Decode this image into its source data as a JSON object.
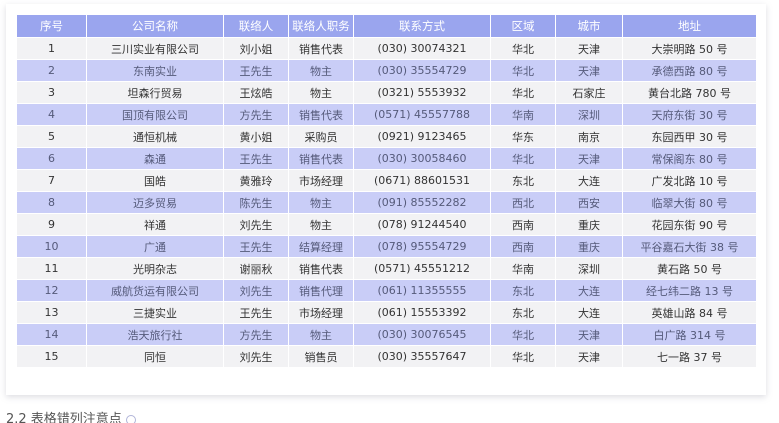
{
  "table": {
    "headers": [
      "序号",
      "公司名称",
      "联络人",
      "联络人职务",
      "联系方式",
      "区域",
      "城市",
      "地址"
    ],
    "rows": [
      [
        "1",
        "三川实业有限公司",
        "刘小姐",
        "销售代表",
        "(030) 30074321",
        "华北",
        "天津",
        "大崇明路 50 号"
      ],
      [
        "2",
        "东南实业",
        "王先生",
        "物主",
        "(030) 35554729",
        "华北",
        "天津",
        "承德西路 80 号"
      ],
      [
        "3",
        "坦森行贸易",
        "王炫皓",
        "物主",
        "(0321) 5553932",
        "华北",
        "石家庄",
        "黄台北路 780 号"
      ],
      [
        "4",
        "国顶有限公司",
        "方先生",
        "销售代表",
        "(0571) 45557788",
        "华南",
        "深圳",
        "天府东街 30 号"
      ],
      [
        "5",
        "通恒机械",
        "黄小姐",
        "采购员",
        "(0921) 9123465",
        "华东",
        "南京",
        "东园西甲 30 号"
      ],
      [
        "6",
        "森通",
        "王先生",
        "销售代表",
        "(030) 30058460",
        "华北",
        "天津",
        "常保阁东 80 号"
      ],
      [
        "7",
        "国皓",
        "黄雅玲",
        "市场经理",
        "(0671) 88601531",
        "东北",
        "大连",
        "广发北路 10 号"
      ],
      [
        "8",
        "迈多贸易",
        "陈先生",
        "物主",
        "(091) 85552282",
        "西北",
        "西安",
        "临翠大街 80 号"
      ],
      [
        "9",
        "祥通",
        "刘先生",
        "物主",
        "(078) 91244540",
        "西南",
        "重庆",
        "花园东街 90 号"
      ],
      [
        "10",
        "广通",
        "王先生",
        "结算经理",
        "(078) 95554729",
        "西南",
        "重庆",
        "平谷嘉石大街 38 号"
      ],
      [
        "11",
        "光明杂志",
        "谢丽秋",
        "销售代表",
        "(0571) 45551212",
        "华南",
        "深圳",
        "黄石路 50 号"
      ],
      [
        "12",
        "威航货运有限公司",
        "刘先生",
        "销售代理",
        "(061) 11355555",
        "东北",
        "大连",
        "经七纬二路 13 号"
      ],
      [
        "13",
        "三捷实业",
        "王先生",
        "市场经理",
        "(061) 15553392",
        "东北",
        "大连",
        "英雄山路 84 号"
      ],
      [
        "14",
        "浩天旅行社",
        "方先生",
        "物主",
        "(030) 30076545",
        "华北",
        "天津",
        "白广路 314 号"
      ],
      [
        "15",
        "同恒",
        "刘先生",
        "销售员",
        "(030) 35557647",
        "华北",
        "天津",
        "七一路 37 号"
      ]
    ]
  },
  "section_heading": "2.2 表格错列注意点",
  "colors": {
    "header_bg": "#9aa5ee",
    "row_odd_bg": "#f2f2f4",
    "row_even_bg": "#c9cdf7"
  },
  "icons": {
    "heading_anchor": "anchor-link-icon"
  }
}
